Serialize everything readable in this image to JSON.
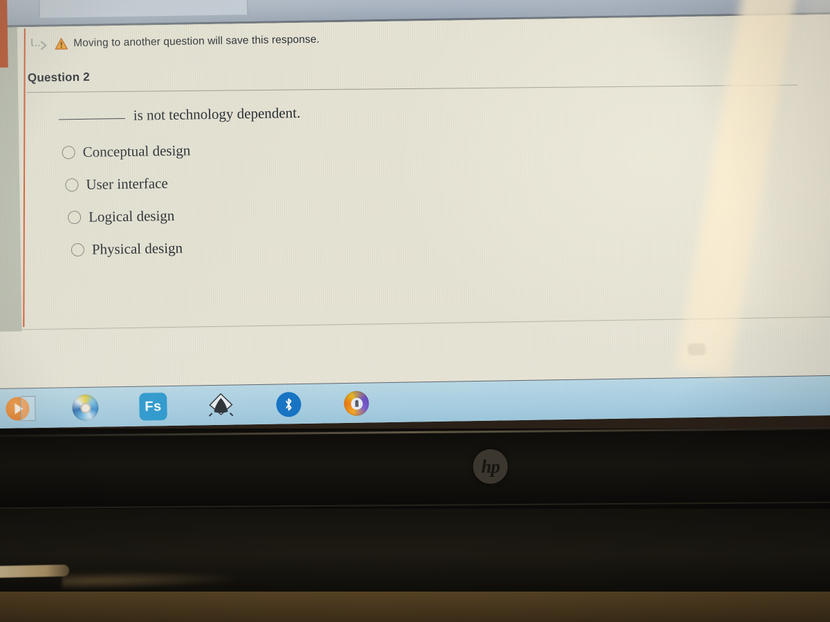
{
  "browser": {
    "tab_strip": "browser-tab-strip"
  },
  "quiz": {
    "warning": {
      "arrow_icon": "dotted-arrow-icon",
      "warning_icon": "warning-triangle-icon",
      "message": "Moving to another question will save this response."
    },
    "question_heading": "Question 2",
    "stem_suffix": "is not technology dependent.",
    "options": [
      {
        "label": "Conceptual design",
        "selected": false
      },
      {
        "label": "User interface",
        "selected": false
      },
      {
        "label": "Logical design",
        "selected": false
      },
      {
        "label": "Physical design",
        "selected": false
      }
    ]
  },
  "taskbar": {
    "items": [
      {
        "name": "media-player-icon",
        "label": ""
      },
      {
        "name": "cd-disc-icon",
        "label": ""
      },
      {
        "name": "fs-app-icon",
        "label": "Fs"
      },
      {
        "name": "inkscape-icon",
        "label": ""
      },
      {
        "name": "bluetooth-icon",
        "label": ""
      },
      {
        "name": "secure-browser-icon",
        "label": ""
      }
    ]
  },
  "laptop": {
    "brand_logo": "hp"
  },
  "colors": {
    "accent_orange": "#d4512a",
    "orange_block": "#b8431c",
    "taskbar_blue": "#a9cfe2",
    "panel_cream": "#e6e3d4",
    "fs_tile_blue": "#2e9ad0",
    "bluetooth_blue": "#1673c4"
  }
}
